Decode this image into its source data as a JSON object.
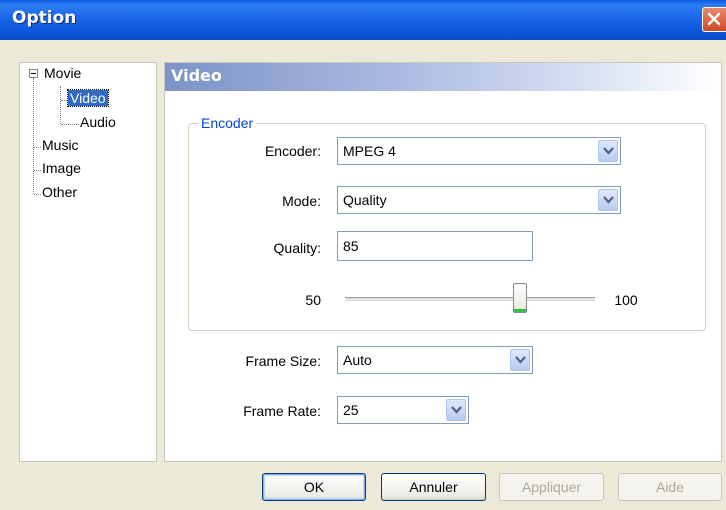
{
  "window": {
    "title": "Option"
  },
  "tree": {
    "items": [
      {
        "label": "Movie"
      },
      {
        "label": "Video"
      },
      {
        "label": "Audio"
      },
      {
        "label": "Music"
      },
      {
        "label": "Image"
      },
      {
        "label": "Other"
      }
    ],
    "selected": "Video"
  },
  "panel": {
    "title": "Video",
    "encoder_group": {
      "label": "Encoder",
      "encoder": {
        "label": "Encoder:",
        "value": "MPEG 4"
      },
      "mode": {
        "label": "Mode:",
        "value": "Quality"
      },
      "quality": {
        "label": "Quality:",
        "value": "85"
      },
      "slider": {
        "min_label": "50",
        "max_label": "100",
        "min": 50,
        "max": 100,
        "value": 85
      }
    },
    "frame_size": {
      "label": "Frame Size:",
      "value": "Auto"
    },
    "frame_rate": {
      "label": "Frame Rate:",
      "value": "25"
    }
  },
  "buttons": {
    "ok": "OK",
    "cancel": "Annuler",
    "apply": "Appliquer",
    "help": "Aide"
  },
  "colors": {
    "title_bar": "#0a5ae0",
    "selection": "#316ac5",
    "group_label": "#0046d5"
  }
}
